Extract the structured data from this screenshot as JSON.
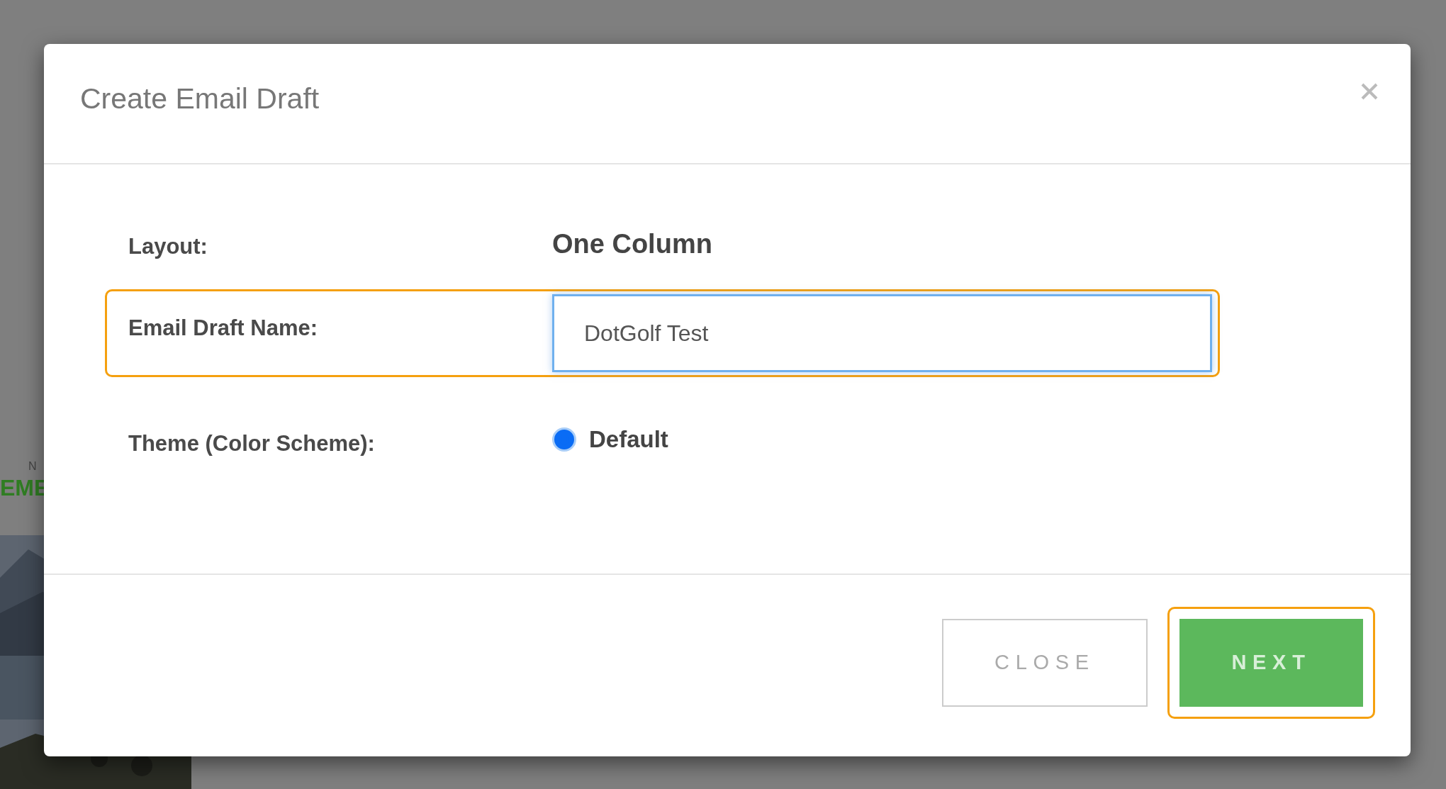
{
  "background": {
    "fragments": [
      {
        "text": "N",
        "kind": "caption"
      },
      {
        "text": "EME",
        "kind": "heading"
      }
    ]
  },
  "dialog": {
    "title": "Create Email Draft",
    "fields": [
      {
        "kind": "text",
        "label": "Layout:",
        "value": "One Column",
        "highlighted": false
      },
      {
        "kind": "input",
        "label": "Email Draft Name:",
        "value": "DotGolf Test",
        "highlighted": true
      },
      {
        "kind": "radio",
        "label": "Theme (Color Scheme):",
        "highlighted": false,
        "options": [
          {
            "label": "Default",
            "selected": true
          }
        ]
      }
    ],
    "buttons": [
      {
        "label": "CLOSE",
        "kind": "secondary",
        "highlighted": false
      },
      {
        "label": "NEXT",
        "kind": "primary",
        "highlighted": true
      }
    ]
  }
}
